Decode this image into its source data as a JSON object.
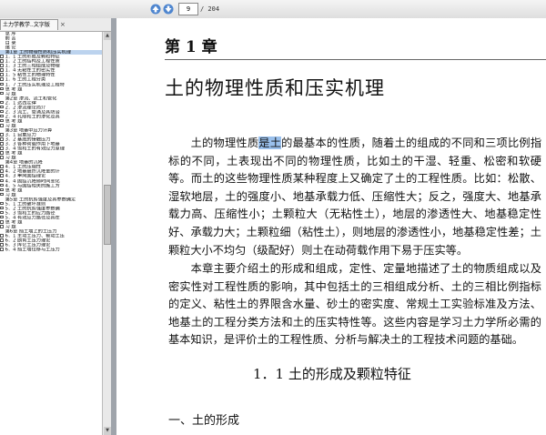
{
  "toolbar": {
    "current_page": "9",
    "total_pages": "/ 204"
  },
  "tab": {
    "title": "土力学教学..文字版",
    "close": "×"
  },
  "toc": [
    {
      "text": "总    序",
      "checkbox": false
    },
    {
      "text": "前    言",
      "checkbox": false
    },
    {
      "text": "目    录",
      "checkbox": false
    },
    {
      "text": "绪    论",
      "checkbox": false
    },
    {
      "text": "第1章 土的物理性质和压实机理",
      "checkbox": false,
      "selected": true
    },
    {
      "text": "1．1  土的形成及颗粒特征",
      "checkbox": true
    },
    {
      "text": "1．2  土的结构及工程性质",
      "checkbox": true
    },
    {
      "text": "1．3  土的三相组成及物理",
      "checkbox": true
    },
    {
      "text": "1．4  无粘性土的密实性",
      "checkbox": true
    },
    {
      "text": "1．5  粘性土的物理特性",
      "checkbox": true
    },
    {
      "text": "1．6  土的工程分类",
      "checkbox": true
    },
    {
      "text": "1．7  土的压实机理及工程特",
      "checkbox": true
    },
    {
      "text": "思    考    题",
      "checkbox": true
    },
    {
      "text": "习    题",
      "checkbox": true
    },
    {
      "text": "第2章 渗流、流土和管化",
      "checkbox": false
    },
    {
      "text": "2．1  达西定律",
      "checkbox": true
    },
    {
      "text": "2．2  渗流理论简介",
      "checkbox": true
    },
    {
      "text": "2．3  流土、管涌及其防治",
      "checkbox": true
    },
    {
      "text": "2．4  孔隙和土的渗化及其",
      "checkbox": true
    },
    {
      "text": "思    考    题",
      "checkbox": true
    },
    {
      "text": "习    题",
      "checkbox": true
    },
    {
      "text": "第3章 地基中应力计算",
      "checkbox": false
    },
    {
      "text": "3．1  自重应力",
      "checkbox": true
    },
    {
      "text": "3．2  基底的接触压力",
      "checkbox": true
    },
    {
      "text": "3．3  各种荷载作用下地基",
      "checkbox": true
    },
    {
      "text": "3．4  饱和土的有效应力原理",
      "checkbox": true
    },
    {
      "text": "思    考    题",
      "checkbox": true
    },
    {
      "text": "习    题",
      "checkbox": true
    },
    {
      "text": "第4章 地基的沉降",
      "checkbox": false
    },
    {
      "text": "4．1  土的压缩性",
      "checkbox": true
    },
    {
      "text": "4．2  地基最终沉降量的计",
      "checkbox": true
    },
    {
      "text": "4．3  单向固结理论",
      "checkbox": true
    },
    {
      "text": "4．4  固结沉降随时间变化",
      "checkbox": true
    },
    {
      "text": "4．5  与固结相关的施工方",
      "checkbox": true
    },
    {
      "text": "思    考    题",
      "checkbox": true
    },
    {
      "text": "习    题",
      "checkbox": true
    },
    {
      "text": "第5章 土的抗剪强度及其参数确定",
      "checkbox": false
    },
    {
      "text": "5．1  土的破坏准则",
      "checkbox": true
    },
    {
      "text": "5．2  土的抗剪强度参数确",
      "checkbox": true
    },
    {
      "text": "5．3  饱和土的应力路径",
      "checkbox": true
    },
    {
      "text": "5．4  有效应力路径及其在",
      "checkbox": true
    },
    {
      "text": "思    考    题",
      "checkbox": true
    },
    {
      "text": "习    题",
      "checkbox": true
    },
    {
      "text": "第6章 挡土墙上的土压力",
      "checkbox": false
    },
    {
      "text": "6．1  主动土压力、被动土压",
      "checkbox": true
    },
    {
      "text": "6．2  朗肯土压力理论",
      "checkbox": true
    },
    {
      "text": "6．3  库仑土压力理论",
      "checkbox": true
    },
    {
      "text": "6．4  挡土墙位移与土压力",
      "checkbox": true
    }
  ],
  "page": {
    "chapter_label": "第 1 章",
    "chapter_title": "土的物理性质和压实机理",
    "p1_before": "土的物理性质",
    "p1_highlight": "是土",
    "p1_after": "的最基本的性质，随着土的组成的不同和三项比例指标的不同，土表现出不同的物理性质，比如土的干湿、轻重、松密和软硬等。而土的这些物理性质某种程度上又确定了土的工程性质。比如：松散、湿软地层，土的强度小、地基承载力低、压缩性大；反之，强度大、地基承载力高、压缩性小；土颗粒大（无粘性土），地层的渗透性大、地基稳定性好、承载力大；土颗粒细（粘性土），则地层的渗透性小，地基稳定性差；土颗粒大小不均匀（级配好）则土在动荷载作用下易于压实等。",
    "p2": "本章主要介绍土的形成和组成，定性、定量地描述了土的物质组成以及密实性对工程性质的影响，其中包括土的三相组成分析、土的三相比例指标的定义、粘性土的界限含水量、砂土的密实度、常规土工实验标准及方法、地基土的工程分类方法和土的压实特性等。这些内容是学习土力学所必需的基本知识，是评价土的工程性质、分析与解决土的工程技术问题的基础。",
    "section_title": "1．1   土的形成及颗粒特征",
    "subsection_title": "一、土的形成"
  },
  "colors": {
    "highlight": "#9ac0ec",
    "toc_selected": "#bcd3ee",
    "divider": "#9fa4ab"
  }
}
